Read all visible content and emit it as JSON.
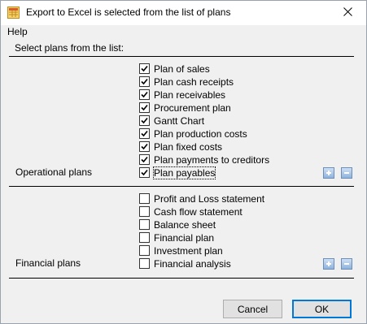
{
  "window": {
    "title": "Export to Excel is selected from the list of plans"
  },
  "menu": {
    "help_label": "Help"
  },
  "instruction": "Select plans from the list:",
  "operational": {
    "group_label": "Operational plans",
    "items": [
      {
        "label": "Plan of sales",
        "checked": true
      },
      {
        "label": "Plan cash receipts",
        "checked": true
      },
      {
        "label": "Plan receivables",
        "checked": true
      },
      {
        "label": "Procurement plan",
        "checked": true
      },
      {
        "label": "Gantt Chart",
        "checked": true
      },
      {
        "label": "Plan production costs",
        "checked": true
      },
      {
        "label": "Plan fixed costs",
        "checked": true
      },
      {
        "label": "Plan payments to creditors",
        "checked": true
      },
      {
        "label": "Plan payables",
        "checked": true
      }
    ]
  },
  "financial": {
    "group_label": "Financial plans",
    "items": [
      {
        "label": "Profit and Loss statement",
        "checked": false
      },
      {
        "label": "Cash flow statement",
        "checked": false
      },
      {
        "label": "Balance sheet",
        "checked": false
      },
      {
        "label": "Financial plan",
        "checked": false
      },
      {
        "label": "Investment plan",
        "checked": false
      },
      {
        "label": "Financial analysis",
        "checked": false
      }
    ]
  },
  "buttons": {
    "cancel_label": "Cancel",
    "ok_label": "OK"
  },
  "colors": {
    "accent": "#0078d7",
    "dialog_bg": "#f0f0f0",
    "mini_button": "#8fb3dc"
  }
}
